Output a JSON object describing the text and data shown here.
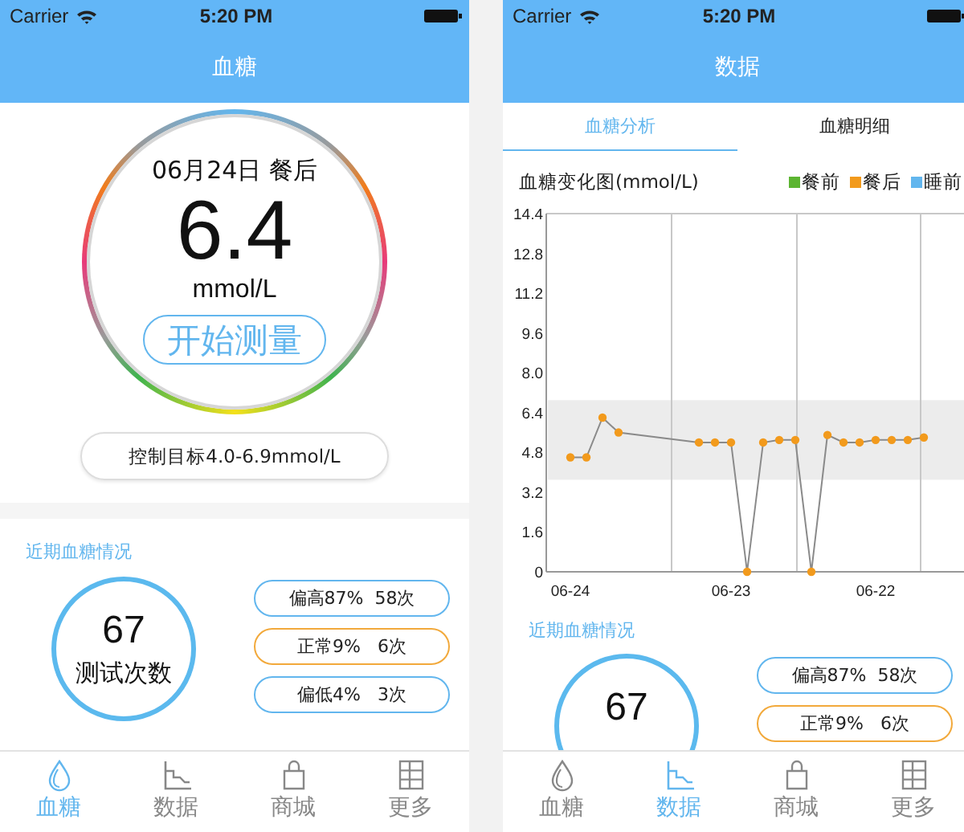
{
  "screens": [
    {
      "kind": "glucose",
      "status_bar": {
        "carrier": "Carrier",
        "time": "5:20 PM"
      },
      "title": "血糖",
      "reading": {
        "date_label": "06月24日 餐后",
        "value": "6.4",
        "unit": "mmol/L",
        "button": "开始测量"
      },
      "target": "控制目标4.0-6.9mmol/L",
      "summary": {
        "title": "近期血糖情况",
        "count": "67",
        "count_label": "测试次数",
        "stats": [
          {
            "label": "偏高87%  58次",
            "color": "#62b6ee"
          },
          {
            "label": "正常9%   6次",
            "color": "#f2a93b"
          },
          {
            "label": "偏低4%   3次",
            "color": "#62b6ee"
          }
        ]
      },
      "tab_bar": [
        {
          "label": "血糖",
          "selected": true
        },
        {
          "label": "数据",
          "selected": false
        },
        {
          "label": "商城",
          "selected": false
        },
        {
          "label": "更多",
          "selected": false
        }
      ]
    },
    {
      "kind": "data",
      "status_bar": {
        "carrier": "Carrier",
        "time": "5:20 PM"
      },
      "title": "数据",
      "tabs": [
        {
          "label": "血糖分析",
          "selected": true
        },
        {
          "label": "血糖明细",
          "selected": false
        }
      ],
      "chart": {
        "title": "血糖变化图(mmol/L)",
        "chart_data": {
          "type": "line",
          "categories": [
            null,
            "06-24",
            null,
            null,
            null,
            null,
            null,
            null,
            null,
            null,
            null,
            "06-23",
            null,
            null,
            null,
            null,
            null,
            null,
            null,
            null,
            "06-22",
            null,
            null,
            null,
            null,
            null
          ],
          "series": [
            {
              "name": "餐前",
              "color": "#5cb531",
              "values": [
                null,
                null,
                null,
                null,
                null,
                null,
                null,
                null,
                null,
                null,
                null,
                null,
                null,
                null,
                null,
                null,
                null,
                null,
                null,
                null,
                null,
                null,
                null,
                null,
                null,
                null
              ]
            },
            {
              "name": "餐后",
              "color": "#f29a1c",
              "marker": "circle",
              "values": [
                null,
                4.6,
                4.6,
                6.2,
                5.6,
                null,
                null,
                null,
                null,
                5.2,
                5.2,
                5.2,
                0,
                5.2,
                5.3,
                5.3,
                0,
                5.5,
                5.2,
                5.2,
                5.3,
                5.3,
                5.3,
                5.4,
                null,
                null
              ]
            },
            {
              "name": "睡前",
              "color": "#62b6ee",
              "values": [
                null,
                null,
                null,
                null,
                null,
                null,
                null,
                null,
                null,
                null,
                null,
                null,
                null,
                null,
                null,
                null,
                null,
                null,
                null,
                null,
                null,
                null,
                null,
                null,
                null,
                null
              ]
            }
          ],
          "ylim": [
            0,
            14.4
          ],
          "yticks": [
            {
              "value": 0,
              "label": "0"
            },
            {
              "value": 1.6,
              "label": "1.6"
            },
            {
              "value": 3.2,
              "label": "3.2"
            },
            {
              "value": 4.8,
              "label": "4.8"
            },
            {
              "value": 6.4,
              "label": "6.4"
            },
            {
              "value": 8,
              "label": "8.0"
            },
            {
              "value": 9.6,
              "label": "9.6"
            },
            {
              "value": 11.2,
              "label": "11.2"
            },
            {
              "value": 12.8,
              "label": "12.8"
            },
            {
              "value": 14.4,
              "label": "14.4"
            }
          ],
          "bands": [
            {
              "axis": "y",
              "from": 3.7,
              "to": 6.9
            }
          ]
        }
      },
      "summary": {
        "title": "近期血糖情况",
        "count": "67",
        "stats": [
          {
            "label": "偏高87%  58次",
            "color": "#62b6ee"
          },
          {
            "label": "正常9%   6次",
            "color": "#f2a93b"
          }
        ]
      },
      "tab_bar": [
        {
          "label": "血糖",
          "selected": false
        },
        {
          "label": "数据",
          "selected": true
        },
        {
          "label": "商城",
          "selected": false
        },
        {
          "label": "更多",
          "selected": false
        }
      ]
    }
  ]
}
